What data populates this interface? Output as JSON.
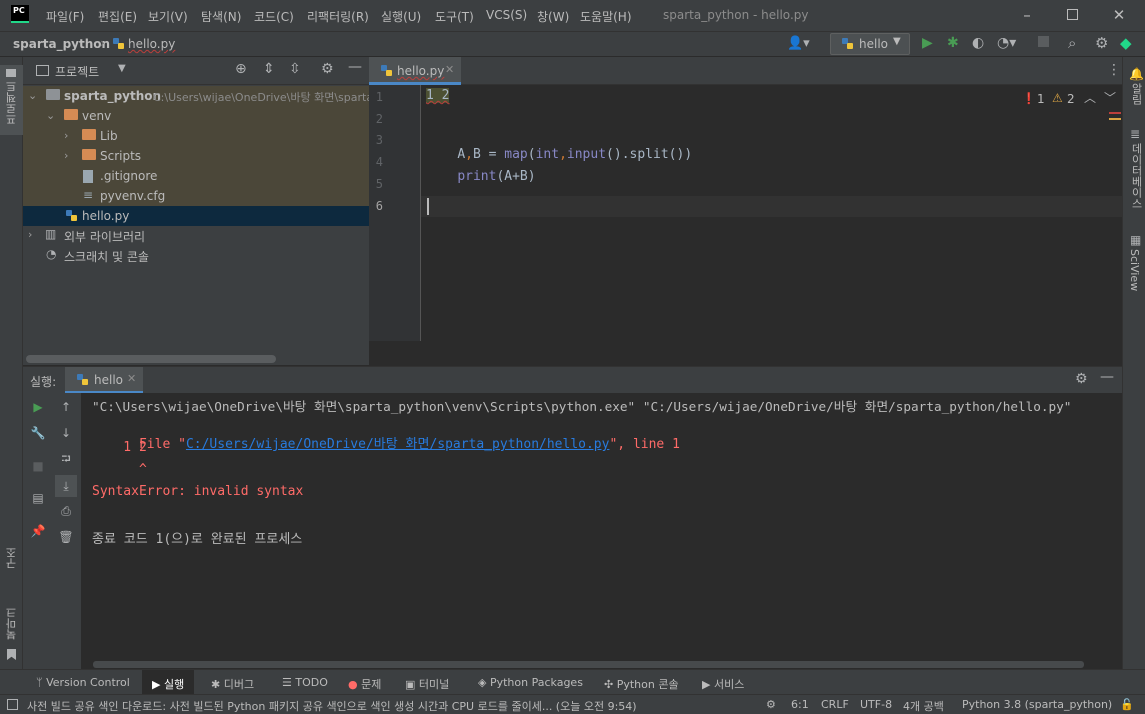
{
  "titlebar": {
    "menu": [
      "파일(F)",
      "편집(E)",
      "보기(V)",
      "탐색(N)",
      "코드(C)",
      "리팩터링(R)",
      "실행(U)",
      "도구(T)",
      "VCS(S)",
      "창(W)",
      "도움말(H)"
    ],
    "window_title": "sparta_python - hello.py",
    "logo": "PC"
  },
  "navbar": {
    "project": "sparta_python",
    "file": "hello.py",
    "run_config": "hello"
  },
  "left_stripe": {
    "project_tab": "프로젝트",
    "structure_tab": "구조",
    "bookmarks_tab": "북마크"
  },
  "right_stripe": {
    "notifications_tab": "알림",
    "database_tab": "데이터베이스",
    "sciview_tab": "SciView"
  },
  "project_panel": {
    "title": "프로젝트",
    "root_name": "sparta_python",
    "root_path": "C:\\Users\\wijae\\OneDrive\\바탕 화면\\sparta_python",
    "items": [
      {
        "label": "venv"
      },
      {
        "label": "Lib"
      },
      {
        "label": "Scripts"
      },
      {
        "label": ".gitignore"
      },
      {
        "label": "pyvenv.cfg"
      },
      {
        "label": "hello.py"
      },
      {
        "label": "외부 라이브러리"
      },
      {
        "label": "스크래치 및 콘솔"
      }
    ]
  },
  "editor": {
    "tab_label": "hello.py",
    "errors": "1",
    "warnings": "2",
    "line_numbers": [
      "1",
      "2",
      "3",
      "4",
      "5",
      "6"
    ],
    "lines": [
      "1 2",
      "",
      "A,B = map(int,input().split())",
      "print(A+B)",
      "",
      ""
    ]
  },
  "run_panel": {
    "label": "실행:",
    "tab": "hello",
    "console": [
      "\"C:\\Users\\wijae\\OneDrive\\바탕 화면\\sparta_python\\venv\\Scripts\\python.exe\" \"C:/Users/wijae/OneDrive/바탕 화면/sparta_python/hello.py\"",
      "  File \"",
      "C:/Users/wijae/OneDrive/바탕 화면/sparta_python/hello.py",
      "\", line 1",
      "    1 2",
      "      ^",
      "SyntaxError: invalid syntax",
      "",
      "종료 코드 1(으)로 완료된 프로세스"
    ]
  },
  "bottom_tabs": [
    "Version Control",
    "실행",
    "디버그",
    "TODO",
    "문제",
    "터미널",
    "Python Packages",
    "Python 콘솔",
    "서비스"
  ],
  "statusbar": {
    "message": "사전 빌드 공유 색인 다운로드: 사전 빌드된 Python 패키지 공유 색인으로 색인 생성 시간과 CPU 로드를 줄이세... (오늘 오전 9:54)",
    "position": "6:1",
    "line_sep": "CRLF",
    "encoding": "UTF-8",
    "indent": "4개 공백",
    "interpreter": "Python 3.8 (sparta_python)"
  },
  "colors": {
    "accent": "#4a88c7",
    "error": "#ff6b68",
    "warning": "#d9a343",
    "run_green": "#499c54",
    "link": "#287bde"
  }
}
